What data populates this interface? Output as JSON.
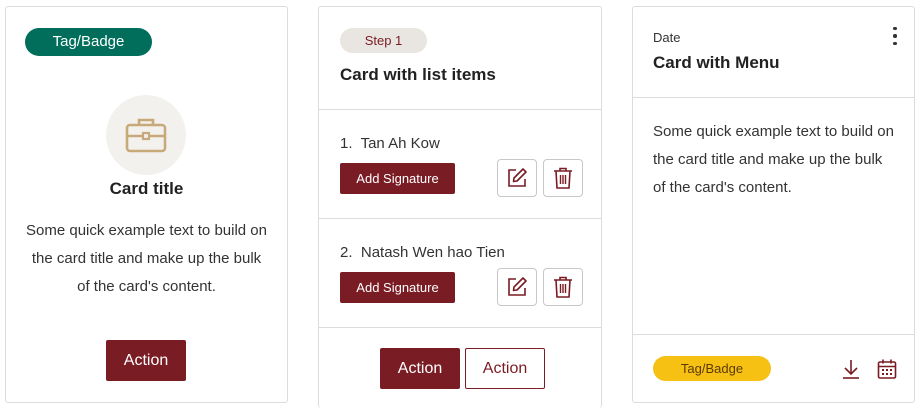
{
  "card1": {
    "tag": "Tag/Badge",
    "icon": "briefcase-icon",
    "title": "Card title",
    "text": "Some quick example text to build on the card title and make up the bulk of the card's content.",
    "action": "Action"
  },
  "card2": {
    "step": "Step 1",
    "title": "Card with list items",
    "items": [
      {
        "number": "1.",
        "name": "Tan Ah Kow",
        "button": "Add Signature"
      },
      {
        "number": "2.",
        "name": "Natash Wen hao Tien",
        "button": "Add Signature"
      }
    ],
    "actions": [
      "Action",
      "Action"
    ]
  },
  "card3": {
    "overline": "Date",
    "title": "Card with Menu",
    "text": "Some quick example text to build on the card title and make up the bulk of the card's content.",
    "tag": "Tag/Badge",
    "icons": [
      "download-icon",
      "calendar-icon",
      "kebab-menu-icon"
    ]
  },
  "colors": {
    "primary": "#7a1c24",
    "tag_green": "#006e5a",
    "tag_yellow": "#f7c114",
    "icon_gold": "#c7a97a"
  }
}
